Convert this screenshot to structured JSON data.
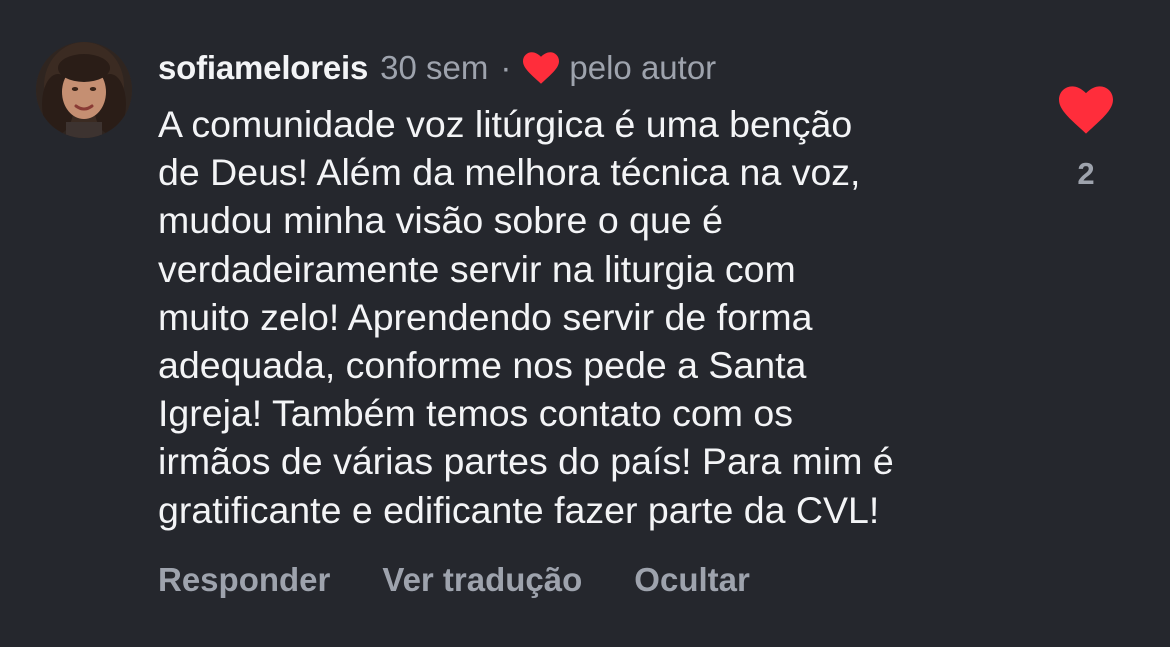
{
  "comment": {
    "username": "sofiameloreis",
    "time": "30 sem",
    "separator": "·",
    "author_like": "pelo autor",
    "text": "A comunidade voz litúrgica é uma benção\nde Deus! Além da melhora técnica na voz,\nmudou minha visão sobre o que é\nverdadeiramente servir na liturgia com\nmuito zelo! Aprendendo servir de forma\nadequada, conforme nos pede a Santa\nIgreja! Também temos contato com os\nirmãos de várias partes do país! Para mim é\ngratificante e edificante fazer parte da CVL!",
    "like_count": "2",
    "liked": true
  },
  "actions": {
    "reply": "Responder",
    "translate": "Ver tradução",
    "hide": "Ocultar"
  },
  "icons": {
    "heart": "heart-icon",
    "author_heart": "heart-icon"
  },
  "colors": {
    "background": "#25272d",
    "text": "#f3f4f6",
    "muted": "#9ea3ad",
    "heart": "#ff2d3b"
  }
}
